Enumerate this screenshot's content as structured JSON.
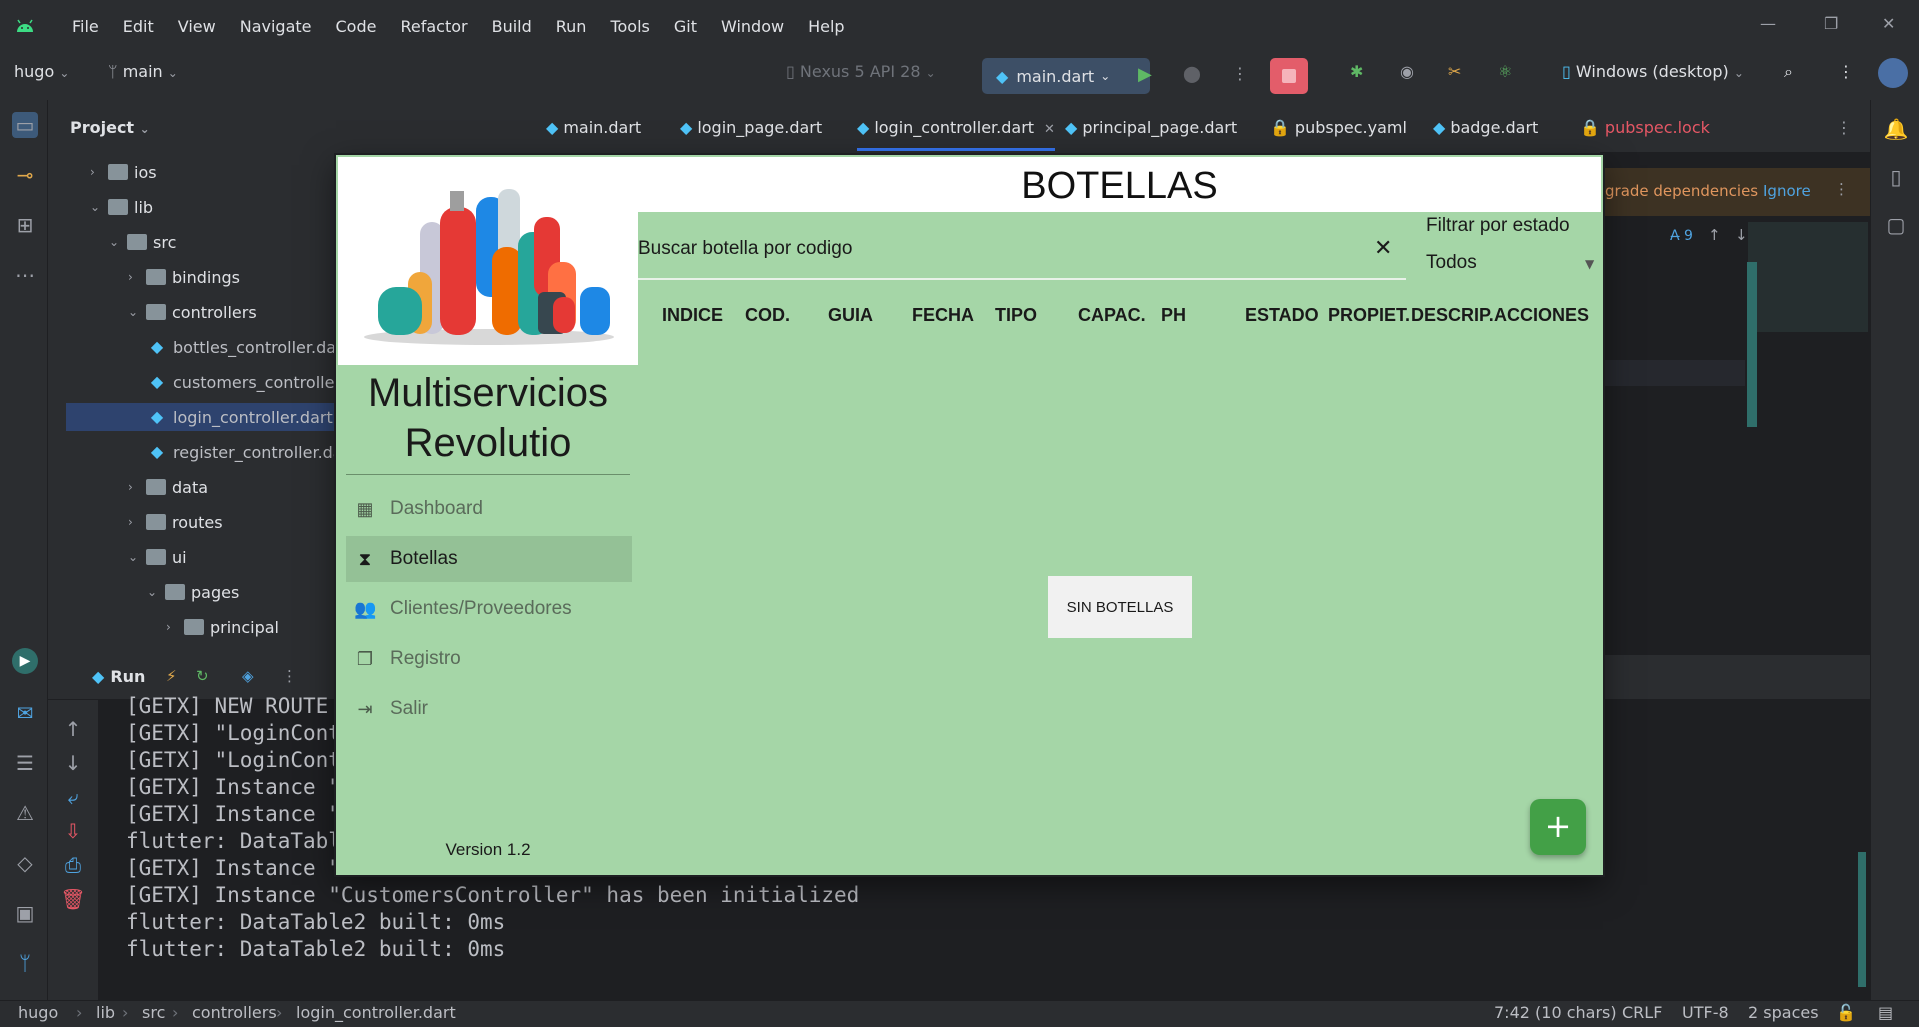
{
  "ide": {
    "menu": [
      "File",
      "Edit",
      "View",
      "Navigate",
      "Code",
      "Refactor",
      "Build",
      "Run",
      "Tools",
      "Git",
      "Window",
      "Help"
    ],
    "toolbar": {
      "project": "hugo",
      "branch": "main",
      "device": "Nexus 5 API 28",
      "run_config": "main.dart",
      "target": "Windows (desktop)"
    },
    "project_panel": {
      "title": "Project",
      "tree": [
        {
          "label": "ios",
          "type": "folder",
          "indent": 0,
          "chev": "›"
        },
        {
          "label": "lib",
          "type": "folder",
          "indent": 0,
          "chev": "⌄"
        },
        {
          "label": "src",
          "type": "folder",
          "indent": 1,
          "chev": "⌄"
        },
        {
          "label": "bindings",
          "type": "folder",
          "indent": 2,
          "chev": "›"
        },
        {
          "label": "controllers",
          "type": "folder",
          "indent": 2,
          "chev": "⌄"
        },
        {
          "label": "bottles_controller.da",
          "type": "dart",
          "indent": 3
        },
        {
          "label": "customers_controller",
          "type": "dart",
          "indent": 3
        },
        {
          "label": "login_controller.dart",
          "type": "dart",
          "indent": 3,
          "selected": true
        },
        {
          "label": "register_controller.da",
          "type": "dart",
          "indent": 3
        },
        {
          "label": "data",
          "type": "folder",
          "indent": 2,
          "chev": "›"
        },
        {
          "label": "routes",
          "type": "folder",
          "indent": 2,
          "chev": "›"
        },
        {
          "label": "ui",
          "type": "folder",
          "indent": 2,
          "chev": "⌄"
        },
        {
          "label": "pages",
          "type": "folder",
          "indent": 3,
          "chev": "⌄"
        },
        {
          "label": "principal",
          "type": "folder",
          "indent": 4,
          "chev": "›"
        }
      ]
    },
    "tabs": [
      {
        "label": "main.dart",
        "x": 0
      },
      {
        "label": "login_page.dart",
        "x": 1
      },
      {
        "label": "login_controller.dart",
        "x": 2,
        "active": true
      },
      {
        "label": "principal_page.dart",
        "x": 3
      },
      {
        "label": "pubspec.yaml",
        "x": 4,
        "lock": true
      },
      {
        "label": "badge.dart",
        "x": 5
      },
      {
        "label": "pubspec.lock",
        "x": 6,
        "lock": true,
        "red": true
      }
    ],
    "banner": {
      "text": "grade dependencies",
      "ignore": "Ignore"
    },
    "inspection_count": "9",
    "run": {
      "title": "Run",
      "console": [
        "[GETX] NEW ROUTE /",
        "[GETX] \"LoginCont",
        "[GETX] \"LoginCont",
        "[GETX] Instance \"",
        "[GETX] Instance \"",
        "flutter: DataTable",
        "[GETX] Instance \"CustomersController\" has been created",
        "[GETX] Instance \"CustomersController\" has been initialized",
        "flutter: DataTable2 built: 0ms",
        "flutter: DataTable2 built: 0ms"
      ]
    },
    "status": {
      "breadcrumb": [
        "hugo",
        "lib",
        "src",
        "controllers",
        "login_controller.dart"
      ],
      "position": "7:42 (10 chars)",
      "line_sep": "CRLF",
      "encoding": "UTF-8",
      "indent": "2 spaces"
    }
  },
  "app": {
    "title": "BOTELLAS",
    "company": "Multiservicios Revolutio",
    "nav": [
      {
        "label": "Dashboard",
        "icon": "dashboard-icon",
        "glyph": "▦"
      },
      {
        "label": "Botellas",
        "icon": "hourglass-icon",
        "glyph": "⧗",
        "active": true
      },
      {
        "label": "Clientes/Proveedores",
        "icon": "people-icon",
        "glyph": "👥"
      },
      {
        "label": "Registro",
        "icon": "copy-icon",
        "glyph": "❐"
      },
      {
        "label": "Salir",
        "icon": "logout-icon",
        "glyph": "⇥"
      }
    ],
    "version": "Version 1.2",
    "search_placeholder": "Buscar botella por codigo",
    "filter": {
      "label": "Filtrar por estado",
      "value": "Todos"
    },
    "columns": [
      "INDICE",
      "COD.",
      "GUIA",
      "FECHA",
      "TIPO",
      "CAPAC.",
      "PH",
      "ESTADO",
      "PROPIET.",
      "DESCRIP.",
      "ACCIONES"
    ],
    "empty_text": "SIN BOTELLAS",
    "fab_label": "+",
    "colors": {
      "background": "#a5d6a7",
      "fab": "#43a047",
      "selected": "#94c196"
    }
  }
}
